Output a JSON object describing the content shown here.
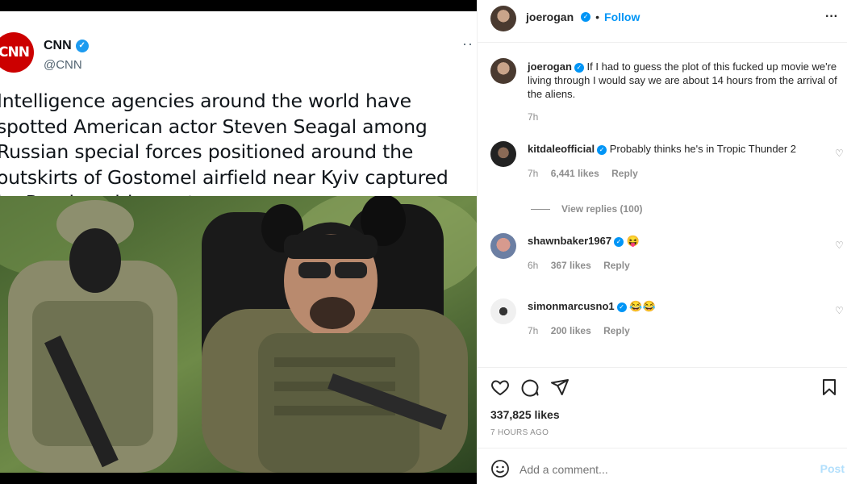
{
  "tweet": {
    "logo_text": "CNN",
    "name": "CNN",
    "handle": "@CNN",
    "more": "··",
    "text": "Intelligence agencies around the world have spotted American actor Steven Seagal among Russian special forces positioned around the outskirts of Gostomel airfield near Kyiv captured by Russian airborne troops."
  },
  "header": {
    "username": "joerogan",
    "separator": "•",
    "follow_label": "Follow",
    "more": "···"
  },
  "caption": {
    "username": "joerogan",
    "text": "If I had to guess the plot of this fucked up movie we're living through I would say we are about 14 hours from the arrival of the aliens.",
    "time": "7h"
  },
  "comments": [
    {
      "username": "kitdaleofficial",
      "text": "Probably thinks he's in Tropic Thunder 2",
      "time": "7h",
      "likes": "6,441 likes",
      "reply": "Reply"
    },
    {
      "username": "shawnbaker1967",
      "text": "😝",
      "time": "6h",
      "likes": "367 likes",
      "reply": "Reply"
    },
    {
      "username": "simonmarcusno1",
      "text": "😂😂",
      "time": "7h",
      "likes": "200 likes",
      "reply": "Reply"
    }
  ],
  "view_replies": "View replies (100)",
  "likes_count": "337,825 likes",
  "posted_ago": "7 HOURS AGO",
  "comment_box": {
    "placeholder": "Add a comment...",
    "post_label": "Post"
  },
  "colors": {
    "accent": "#0095f6",
    "cnn_red": "#cc0000",
    "twitter_blue": "#1d9bf0"
  }
}
